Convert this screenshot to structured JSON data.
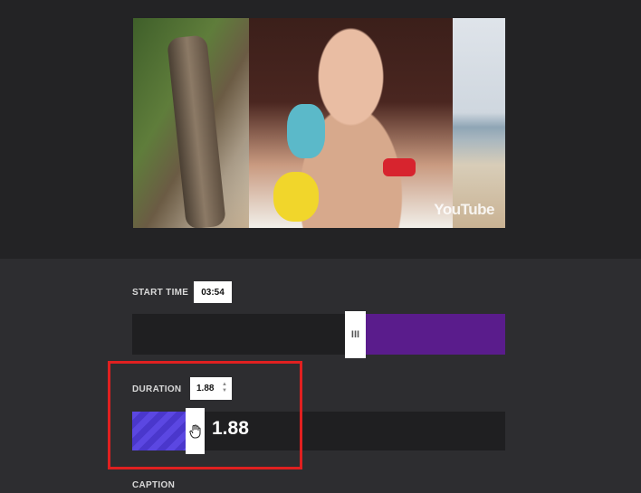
{
  "video": {
    "watermark": "YouTube",
    "thumbnail_icon": "video-frame"
  },
  "start_time": {
    "label": "START TIME",
    "value": "03:54",
    "handle_glyph": "III",
    "slider_position": 0.57,
    "fill_color": "#5a1c8c"
  },
  "duration": {
    "label": "DURATION",
    "value": "1.88",
    "readout": "1.88",
    "stepper_up": "▲",
    "stepper_down": "▼",
    "fill_fraction": 0.14,
    "fill_color": "#5b47e2",
    "cursor_icon": "hand-cursor-icon"
  },
  "caption": {
    "label": "CAPTION"
  },
  "annotation": {
    "highlight_color": "#e02020"
  }
}
